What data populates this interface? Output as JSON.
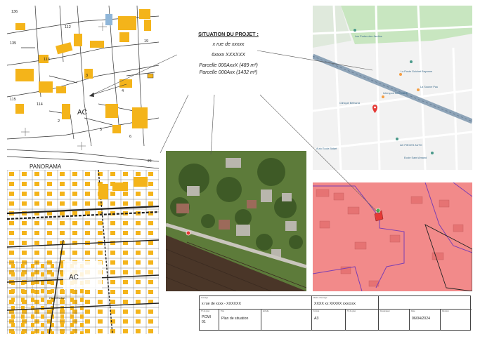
{
  "situation": {
    "title": "SITUATION DU PROJET :",
    "address": "x rue de xxxxx",
    "city": "6xxxx XXXXXX",
    "parcel1": "Parcelle 000AxxX (489 m²)",
    "parcel2": "Parcelle 000Axx (1432 m²)"
  },
  "cadastre_top": {
    "labels": [
      "136",
      "112",
      "19",
      "135",
      "113",
      "3",
      "115",
      "114",
      "4",
      "AC",
      "2",
      "5",
      "6",
      "PANORAMA",
      "23"
    ]
  },
  "cadastre_bottom": {
    "labels": [
      "AC",
      "PANORAMA"
    ]
  },
  "street_map": {
    "places": [
      "Les Portes des Jardins",
      "Intersport BAYONNE",
      "La Poste Guichet Bayonne",
      "Clinique Belharra",
      "La Source Pau",
      "Auto Ecole Bidart",
      "AD PIECES AUTO",
      "Ecole Saint Amand"
    ]
  },
  "cartouche": {
    "headers": {
      "ouvrage": "Ouvrage",
      "maitre": "Maître d'ouvrage",
      "plan_no": "N° de plan",
      "titre": "Titre",
      "echelle": "Echelle",
      "format": "Format",
      "indice": "N° de plan",
      "dessinateur": "Dessinateur",
      "date": "Date",
      "revision": "Révision"
    },
    "ouvrage": "x rue de xxxx - XXXXXX",
    "maitre": "XXXX xx XXXXX xxxxxxx",
    "plan_no": "PCMI",
    "plan_no2": "01",
    "titre": "Plan de situation",
    "echelle": "",
    "format": "A3",
    "dessinateur": "",
    "date": "06/04/2024",
    "revision": ""
  },
  "colors": {
    "building": "#f4b41a",
    "map_bg": "#f2f2f2",
    "park": "#c8e6c0",
    "road": "#ffffff",
    "rail": "#8ea4b8",
    "parcel_pink": "#f28a8a",
    "parcel_border": "#7b3fb3",
    "pin_red": "#e53935",
    "pin_green": "#4caf50"
  }
}
